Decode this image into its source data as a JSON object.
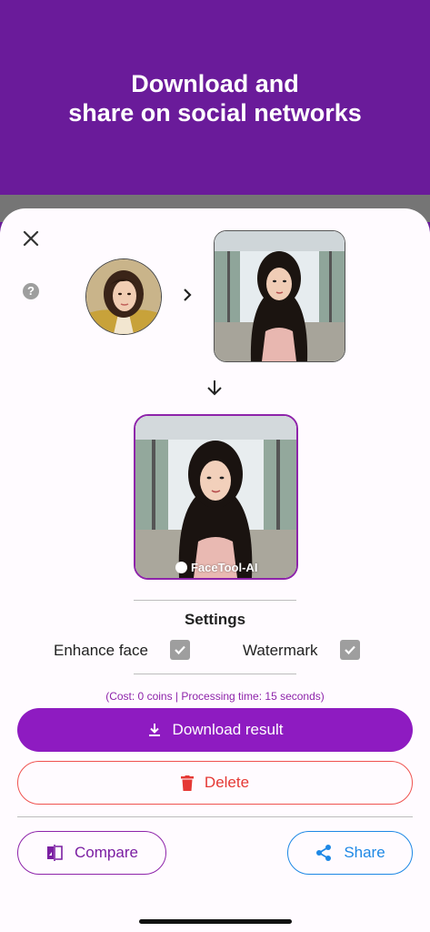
{
  "banner": {
    "title": "Download and\nshare on social networks"
  },
  "sheet": {
    "close_icon": "close-icon",
    "help_icon": "help-icon",
    "help_glyph": "?",
    "watermark_text": "FaceTool-AI"
  },
  "settings": {
    "title": "Settings",
    "enhance_face_label": "Enhance face",
    "enhance_face_checked": true,
    "watermark_label": "Watermark",
    "watermark_checked": true
  },
  "cost_text": "(Cost: 0 coins | Processing time: 15 seconds)",
  "buttons": {
    "download_label": "Download result",
    "delete_label": "Delete",
    "compare_label": "Compare",
    "share_label": "Share"
  },
  "colors": {
    "banner": "#6a1b9a",
    "accent": "#8e1bc1",
    "danger": "#e53935",
    "share": "#1e88e5"
  }
}
